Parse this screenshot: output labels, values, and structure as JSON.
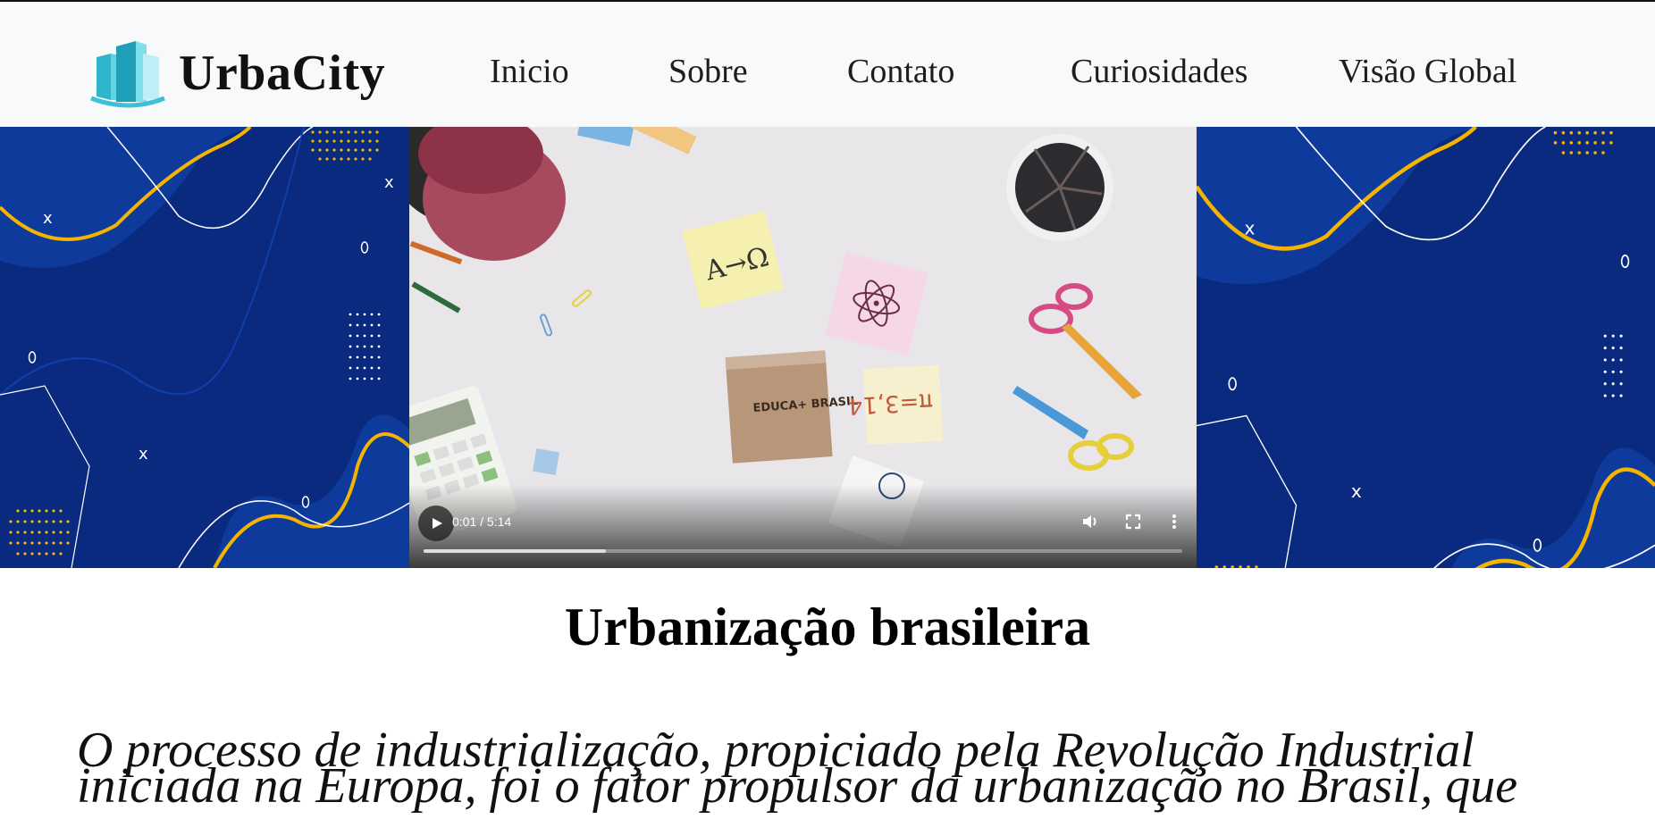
{
  "brand": {
    "name": "UrbaCity",
    "logo_icon": "city-buildings-icon",
    "accent": "#3ec1d6"
  },
  "nav": {
    "items": [
      "Inicio",
      "Sobre",
      "Contato",
      "Curiosidades",
      "Visão Global"
    ]
  },
  "hero": {
    "background_color": "#0a2a80",
    "wave_color": "#f5b400",
    "video": {
      "current_time": "0:01",
      "duration": "5:14",
      "time_display": "0:01 / 5:14",
      "progress": 0.24,
      "box_label": "EDUCA+ BRASIL",
      "note_pi": "π=3,14",
      "controls": [
        "play-icon",
        "volume-icon",
        "fullscreen-icon",
        "more-options-icon"
      ]
    }
  },
  "main": {
    "title": "Urbanização brasileira",
    "intro_line1": "O processo de industrialização, propiciado pela Revolução Industrial",
    "intro_line2": "iniciada na Europa, foi o fator propulsor da urbanização no Brasil, que"
  }
}
